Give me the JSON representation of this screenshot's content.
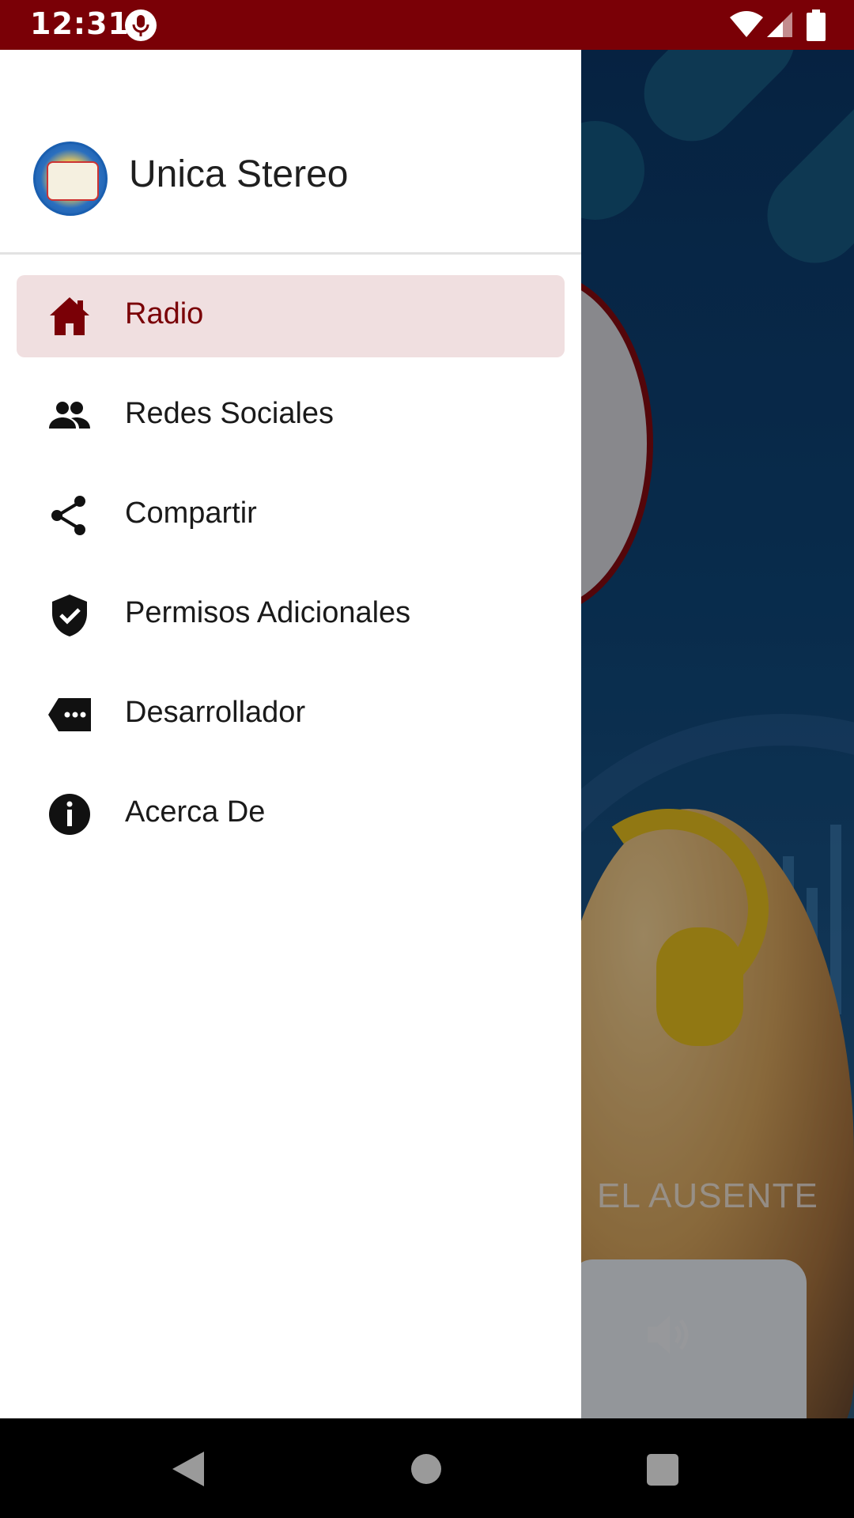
{
  "status_bar": {
    "time": "12:31",
    "background": "#7a0006"
  },
  "background_app": {
    "song_title": "EL AUSENTE"
  },
  "drawer": {
    "app_name": "Unica Stereo",
    "items": [
      {
        "label": "Radio",
        "icon": "home-icon",
        "active": true
      },
      {
        "label": "Redes Sociales",
        "icon": "people-icon",
        "active": false
      },
      {
        "label": "Compartir",
        "icon": "share-icon",
        "active": false
      },
      {
        "label": "Permisos Adicionales",
        "icon": "shield-check-icon",
        "active": false
      },
      {
        "label": "Desarrollador",
        "icon": "label-dots-icon",
        "active": false
      },
      {
        "label": "Acerca De",
        "icon": "info-icon",
        "active": false
      }
    ]
  },
  "colors": {
    "accent": "#7a0006",
    "active_item_bg": "#f0dfe0"
  }
}
